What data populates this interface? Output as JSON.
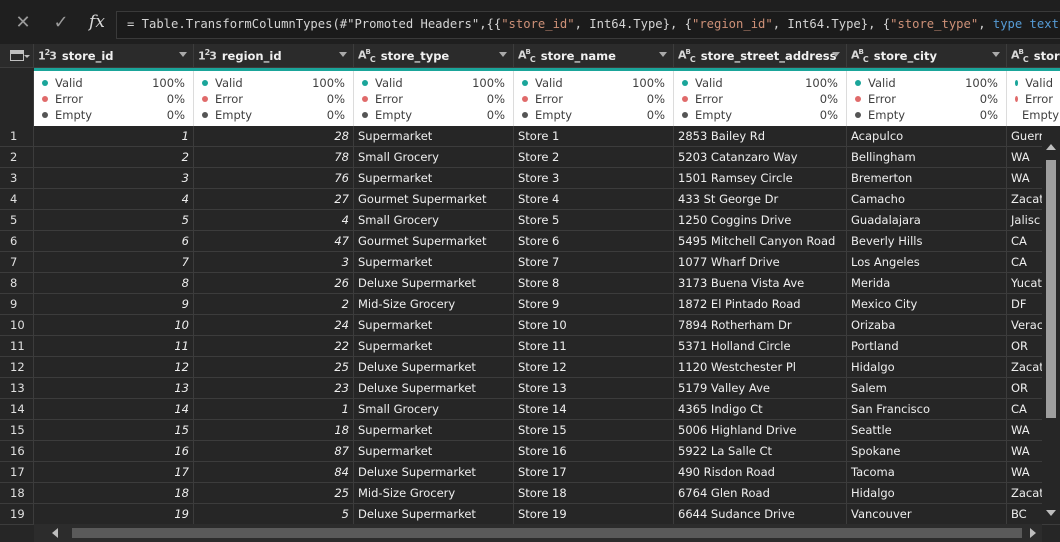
{
  "formula_bar": {
    "cancel_icon": "x-icon",
    "commit_icon": "check-icon",
    "fx_label": "fx",
    "formula_parts": [
      {
        "t": "= Table.TransformColumnTypes(#",
        "c": ""
      },
      {
        "t": "\"Promoted Headers\"",
        "c": ""
      },
      {
        "t": ",{{",
        "c": ""
      },
      {
        "t": "\"store_id\"",
        "c": "str"
      },
      {
        "t": ", Int64.Type}, {",
        "c": ""
      },
      {
        "t": "\"region_id\"",
        "c": "str"
      },
      {
        "t": ", Int64.Type}, {",
        "c": ""
      },
      {
        "t": "\"store_type\"",
        "c": "str"
      },
      {
        "t": ", ",
        "c": ""
      },
      {
        "t": "type text",
        "c": "kw"
      },
      {
        "t": "},",
        "c": ""
      }
    ]
  },
  "quality_labels": {
    "valid": "Valid",
    "error": "Error",
    "empty": "Empty"
  },
  "quality_colors": {
    "valid": "#1aa59a",
    "error": "#e06a6a",
    "empty": "#555555"
  },
  "columns": [
    {
      "name": "store_id",
      "type": "123",
      "numeric": true,
      "valid": "100%",
      "error": "0%",
      "empty": "0%"
    },
    {
      "name": "region_id",
      "type": "123",
      "numeric": true,
      "valid": "100%",
      "error": "0%",
      "empty": "0%"
    },
    {
      "name": "store_type",
      "type": "ABC",
      "numeric": false,
      "valid": "100%",
      "error": "0%",
      "empty": "0%"
    },
    {
      "name": "store_name",
      "type": "ABC",
      "numeric": false,
      "valid": "100%",
      "error": "0%",
      "empty": "0%"
    },
    {
      "name": "store_street_address",
      "type": "ABC",
      "numeric": false,
      "valid": "100%",
      "error": "0%",
      "empty": "0%"
    },
    {
      "name": "store_city",
      "type": "ABC",
      "numeric": false,
      "valid": "100%",
      "error": "0%",
      "empty": "0%"
    },
    {
      "name": "store",
      "type": "ABC",
      "numeric": false,
      "valid": "",
      "error": "",
      "empty": ""
    }
  ],
  "rows": [
    [
      "1",
      "28",
      "Supermarket",
      "Store 1",
      "2853 Bailey Rd",
      "Acapulco",
      "Guerr"
    ],
    [
      "2",
      "78",
      "Small Grocery",
      "Store 2",
      "5203 Catanzaro Way",
      "Bellingham",
      "WA"
    ],
    [
      "3",
      "76",
      "Supermarket",
      "Store 3",
      "1501 Ramsey Circle",
      "Bremerton",
      "WA"
    ],
    [
      "4",
      "27",
      "Gourmet Supermarket",
      "Store 4",
      "433 St George Dr",
      "Camacho",
      "Zacate"
    ],
    [
      "5",
      "4",
      "Small Grocery",
      "Store 5",
      "1250 Coggins Drive",
      "Guadalajara",
      "Jalisc"
    ],
    [
      "6",
      "47",
      "Gourmet Supermarket",
      "Store 6",
      "5495 Mitchell Canyon Road",
      "Beverly Hills",
      "CA"
    ],
    [
      "7",
      "3",
      "Supermarket",
      "Store 7",
      "1077 Wharf Drive",
      "Los Angeles",
      "CA"
    ],
    [
      "8",
      "26",
      "Deluxe Supermarket",
      "Store 8",
      "3173 Buena Vista Ave",
      "Merida",
      "Yucata"
    ],
    [
      "9",
      "2",
      "Mid-Size Grocery",
      "Store 9",
      "1872 El Pintado Road",
      "Mexico City",
      "DF"
    ],
    [
      "10",
      "24",
      "Supermarket",
      "Store 10",
      "7894 Rotherham Dr",
      "Orizaba",
      "Veraci"
    ],
    [
      "11",
      "22",
      "Supermarket",
      "Store 11",
      "5371 Holland Circle",
      "Portland",
      "OR"
    ],
    [
      "12",
      "25",
      "Deluxe Supermarket",
      "Store 12",
      "1120 Westchester Pl",
      "Hidalgo",
      "Zacate"
    ],
    [
      "13",
      "23",
      "Deluxe Supermarket",
      "Store 13",
      "5179 Valley Ave",
      "Salem",
      "OR"
    ],
    [
      "14",
      "1",
      "Small Grocery",
      "Store 14",
      "4365 Indigo Ct",
      "San Francisco",
      "CA"
    ],
    [
      "15",
      "18",
      "Supermarket",
      "Store 15",
      "5006 Highland Drive",
      "Seattle",
      "WA"
    ],
    [
      "16",
      "87",
      "Supermarket",
      "Store 16",
      "5922 La Salle Ct",
      "Spokane",
      "WA"
    ],
    [
      "17",
      "84",
      "Deluxe Supermarket",
      "Store 17",
      "490 Risdon Road",
      "Tacoma",
      "WA"
    ],
    [
      "18",
      "25",
      "Mid-Size Grocery",
      "Store 18",
      "6764 Glen Road",
      "Hidalgo",
      "Zacate"
    ],
    [
      "19",
      "5",
      "Deluxe Supermarket",
      "Store 19",
      "6644 Sudance Drive",
      "Vancouver",
      "BC"
    ]
  ]
}
